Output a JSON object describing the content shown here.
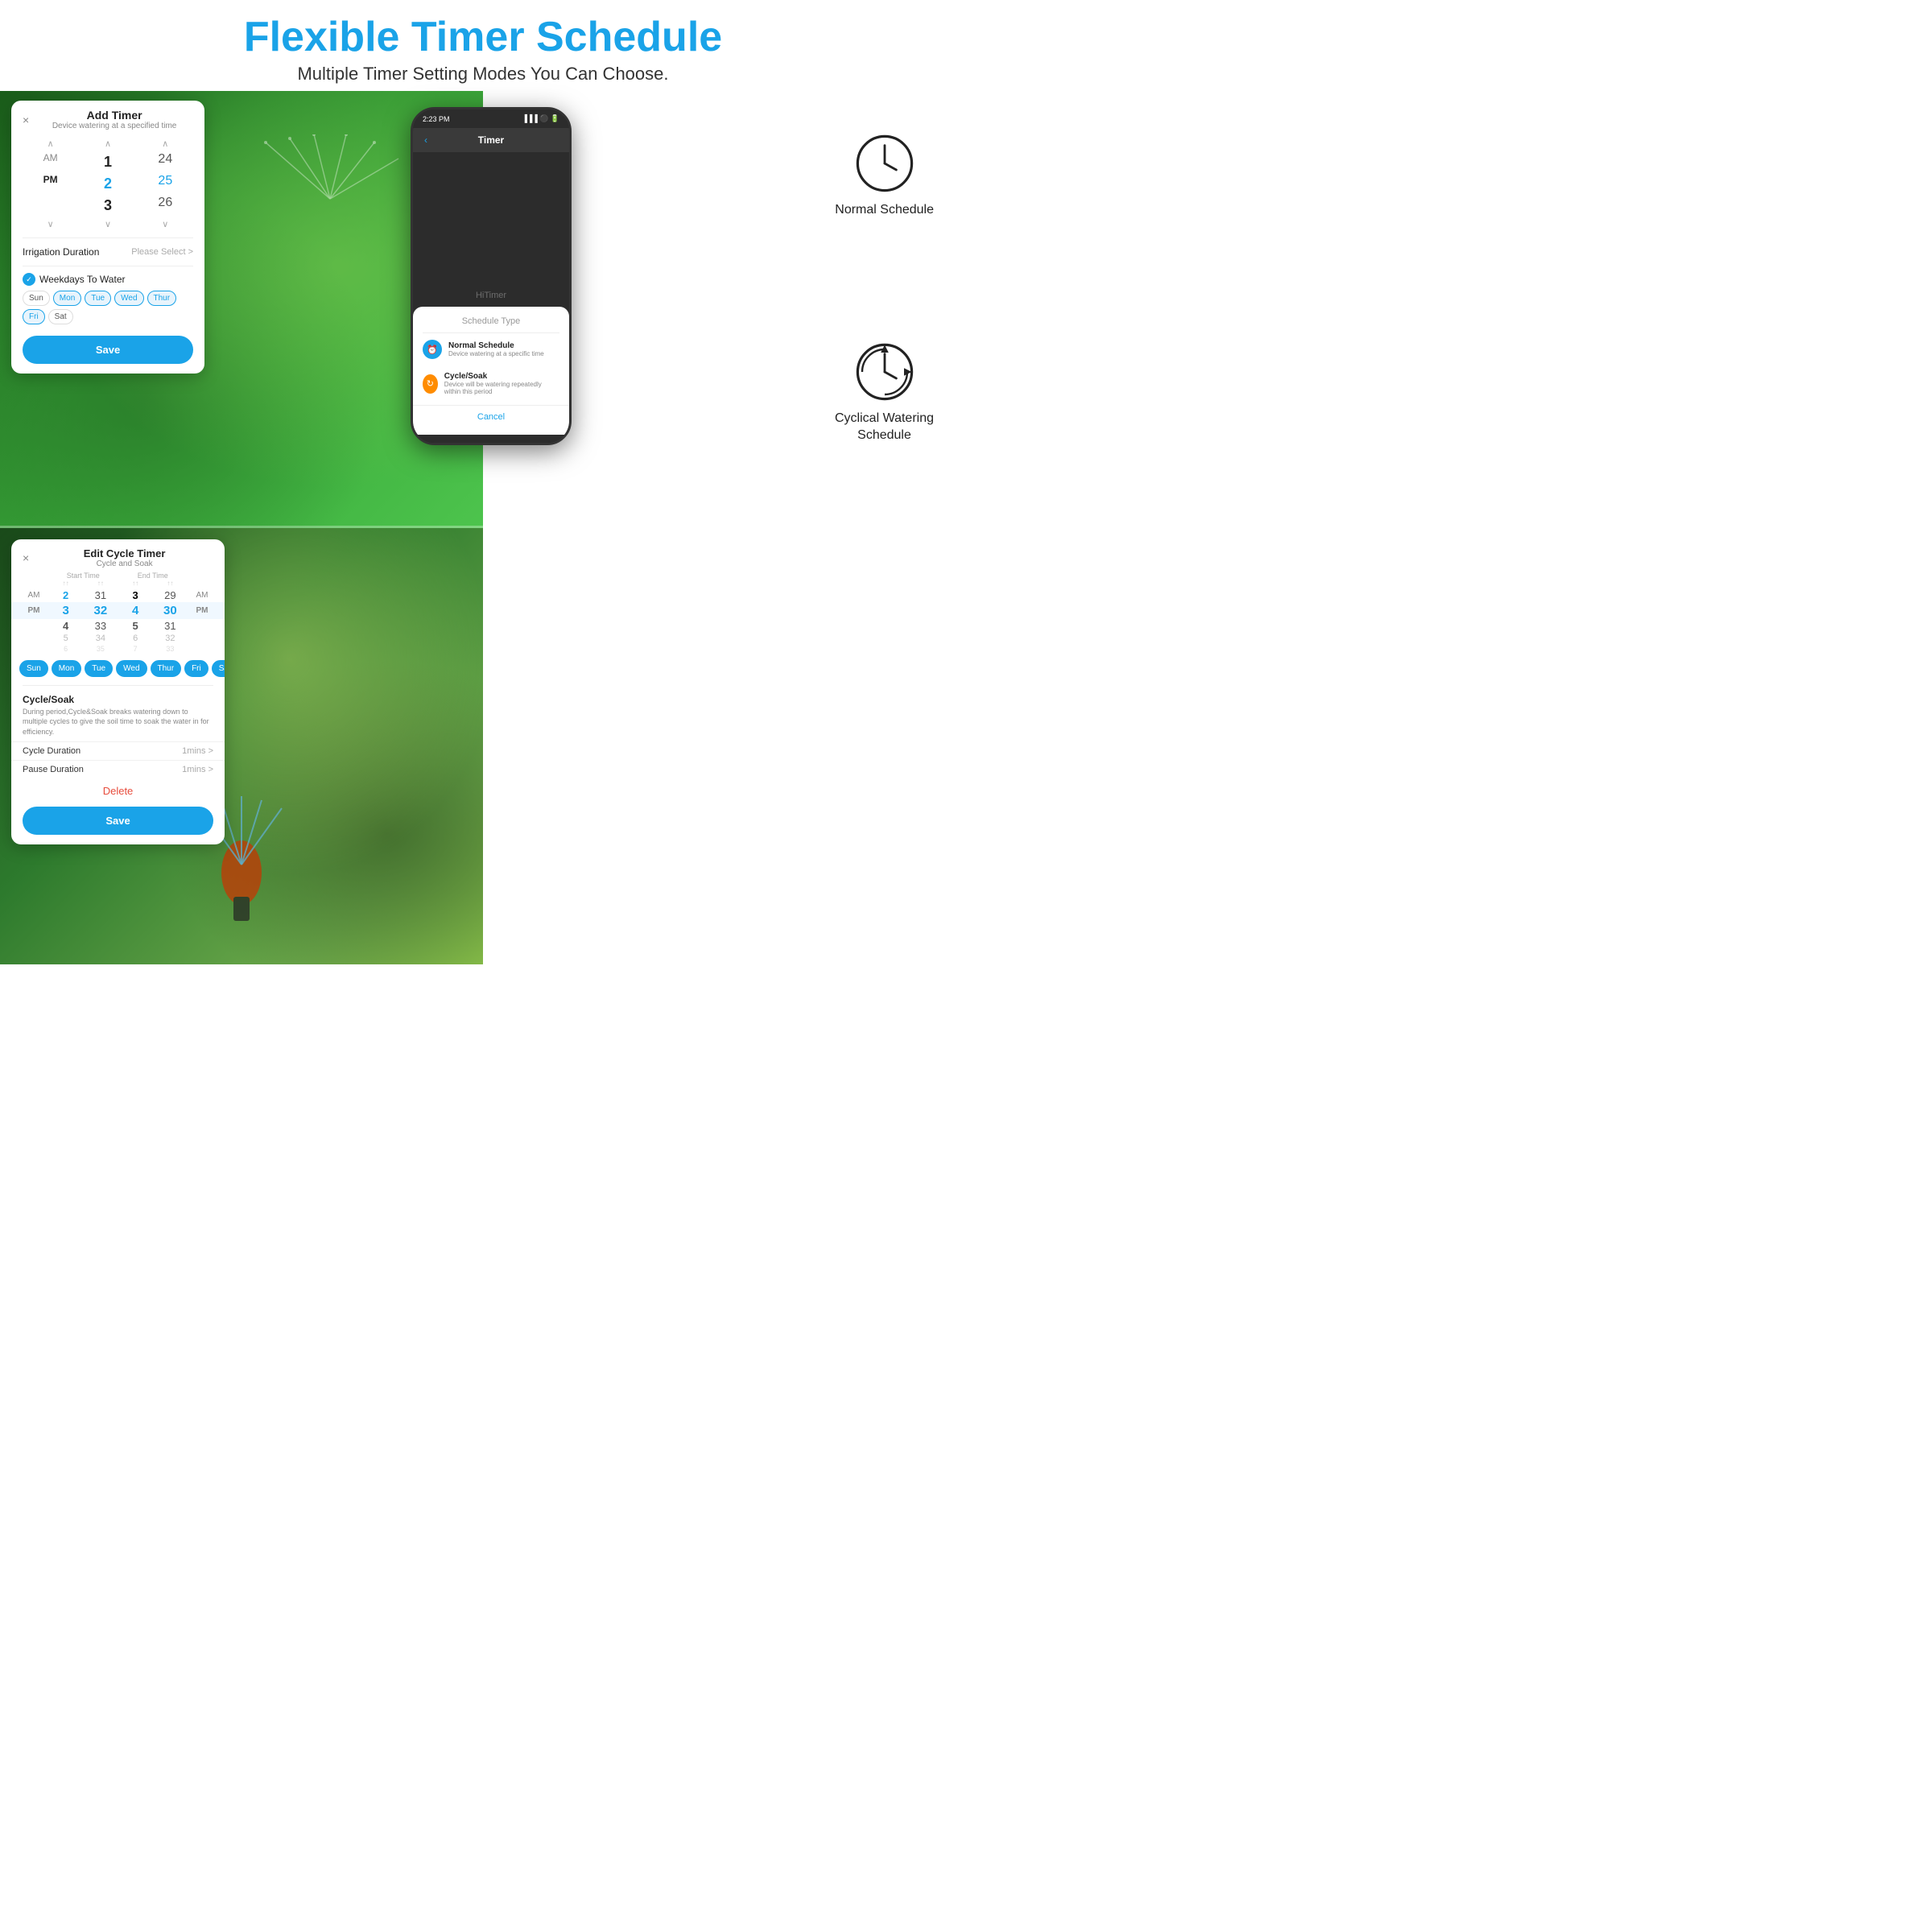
{
  "header": {
    "title": "Flexible Timer Schedule",
    "subtitle": "Multiple Timer Setting Modes You Can Choose."
  },
  "topCard": {
    "close": "×",
    "title": "Add Timer",
    "subtitle": "Device watering at a specified time",
    "timeRows": [
      {
        "ampm": "AM",
        "col1": "1",
        "col2": "24"
      },
      {
        "ampm": "PM",
        "col1": "2",
        "col2": "25"
      },
      {
        "ampm": "",
        "col1": "3",
        "col2": "26"
      }
    ],
    "irrigationLabel": "Irrigation Duration",
    "irrigationSelect": "Please Select >",
    "weekdaysLabel": "Weekdays To Water",
    "days": [
      "Sun",
      "Mon",
      "Tue",
      "Wed",
      "Thur",
      "Fri",
      "Sat"
    ],
    "saveLabel": "Save"
  },
  "cycleCard": {
    "close": "×",
    "title": "Edit Cycle Timer",
    "subtitle": "Cycle and Soak",
    "colHeaders": [
      "",
      "Start Time",
      "",
      "End Time",
      "",
      ""
    ],
    "timeRows": [
      {
        "ampm": "AM",
        "s1": "2",
        "s2": "31",
        "e1": "3",
        "e2": "29",
        "ampmR": "AM"
      },
      {
        "ampm": "PM",
        "s1": "3",
        "s2": "32",
        "e1": "4",
        "e2": "30",
        "ampmR": "PM"
      },
      {
        "ampm": "",
        "s1": "4",
        "s2": "33",
        "e1": "5",
        "e2": "31",
        "ampmR": ""
      },
      {
        "ampm": "",
        "s1": "5",
        "s2": "34",
        "e1": "6",
        "e2": "32",
        "ampmR": ""
      },
      {
        "ampm": "",
        "s1": "6",
        "s2": "35",
        "e1": "7",
        "e2": "33",
        "ampmR": ""
      }
    ],
    "days": [
      "Sun",
      "Mon",
      "Tue",
      "Wed",
      "Thur",
      "Fri",
      "Sat"
    ],
    "activeDays": [
      0,
      1,
      2,
      3,
      4,
      5,
      6
    ],
    "cycleSoakTitle": "Cycle/Soak",
    "cycleSoakDesc": "During period,Cycle&Soak breaks watering down to multiple cycles to give the soil time to soak the water in for efficiency.",
    "cycleDurationLabel": "Cycle Duration",
    "cycleDurationVal": "1mins >",
    "pauseDurationLabel": "Pause  Duration",
    "pauseDurationVal": "1mins >",
    "deleteLabel": "Delete",
    "saveLabel": "Save"
  },
  "phone": {
    "time": "2:23 PM",
    "navTitle": "Timer",
    "navBack": "‹",
    "watermark": "HiTimer",
    "scheduleTypeTitle": "Schedule Type",
    "normalSchedule": {
      "label": "Normal Schedule",
      "desc": "Device watering  at a specific time"
    },
    "cycleSoak": {
      "label": "Cycle/Soak",
      "desc": "Device will be watering repeatedly within this period"
    },
    "cancelLabel": "Cancel"
  },
  "rightIcons": {
    "normalScheduleLabel": "Normal Schedule",
    "cyclicalLabel1": "Cyclical Watering",
    "cyclicalLabel2": "Schedule"
  }
}
